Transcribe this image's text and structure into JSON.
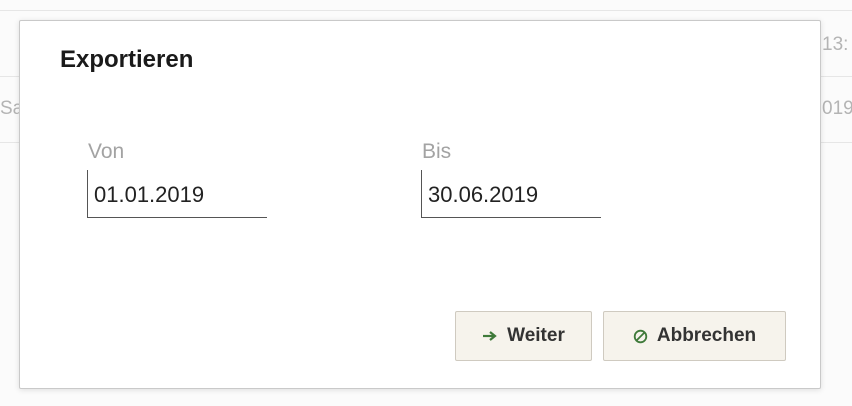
{
  "background": {
    "row1_tail": "13:",
    "row2_head": "Sa",
    "row2_tail": "019"
  },
  "dialog": {
    "title": "Exportieren",
    "from": {
      "label": "Von",
      "value": "01.01.2019"
    },
    "to": {
      "label": "Bis",
      "value": "30.06.2019"
    },
    "buttons": {
      "next_label": "Weiter",
      "next_icon": "arrow-right-icon",
      "cancel_label": "Abbrechen",
      "cancel_icon": "no-entry-icon"
    }
  },
  "colors": {
    "button_bg": "#f6f3ec",
    "icon_green": "#3f7a3a",
    "label_gray": "#a3a3a3"
  }
}
